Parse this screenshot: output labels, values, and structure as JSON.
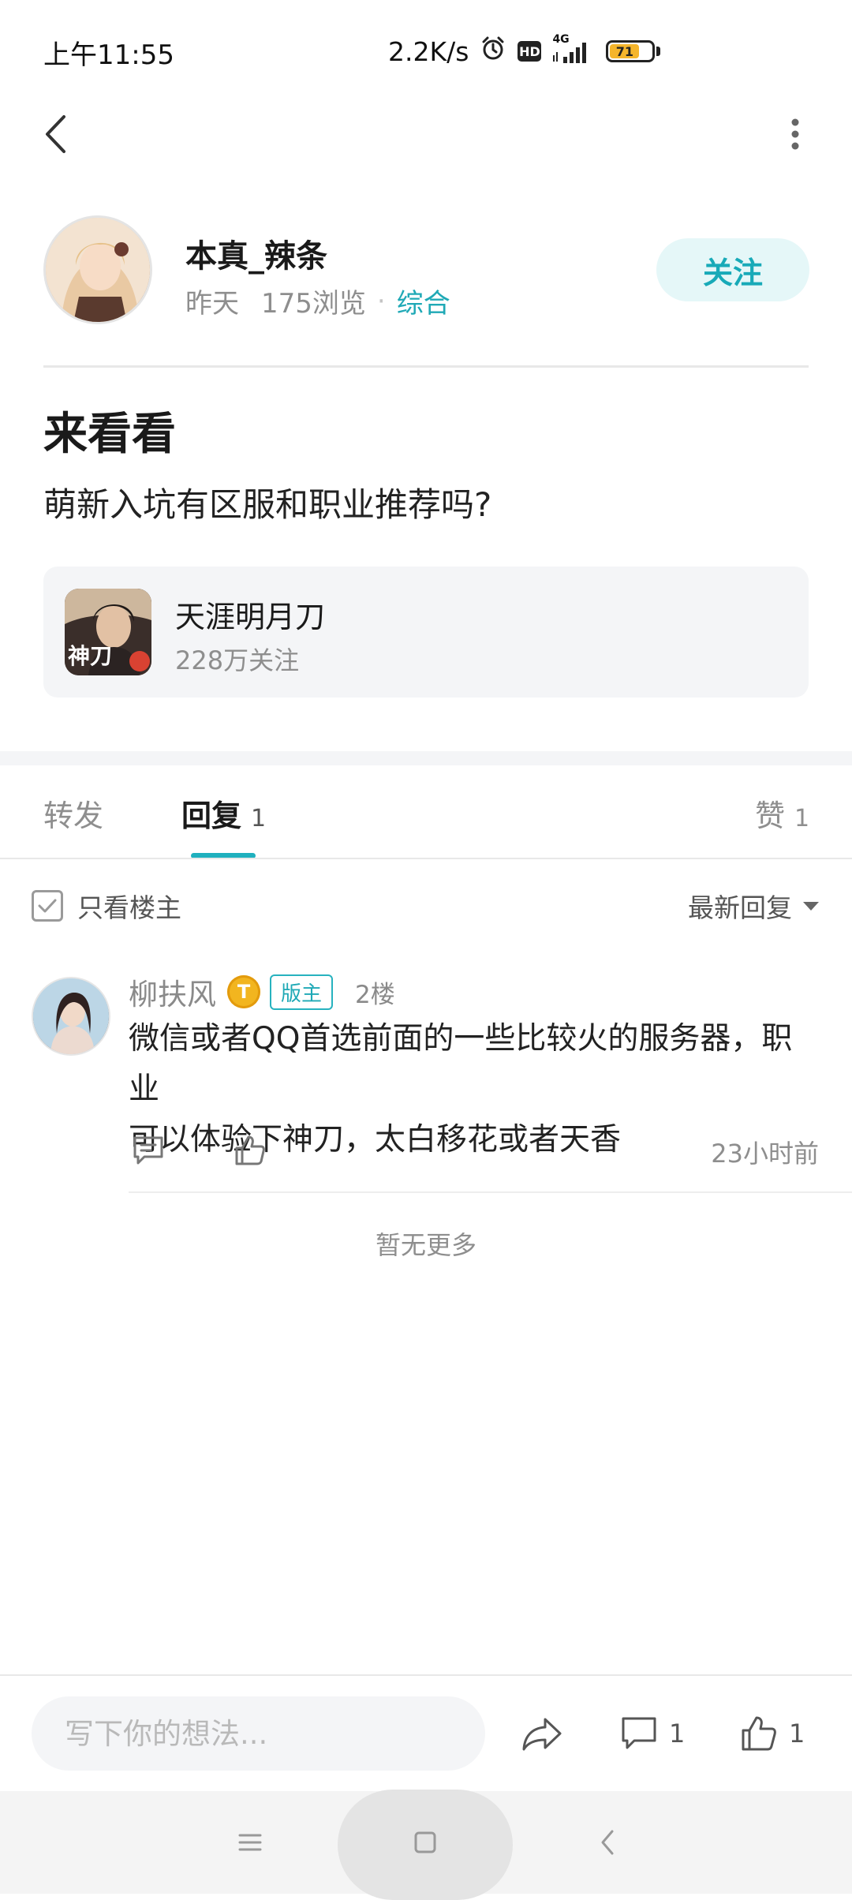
{
  "status_bar": {
    "time": "上午11:55",
    "speed": "2.2K/s",
    "hd": "HD",
    "network": "4G",
    "battery": "71",
    "battery_level": 0.71
  },
  "author": {
    "name": "本真_辣条",
    "date": "昨天",
    "views": "175浏览",
    "separator": "·",
    "category": "综合",
    "follow_label": "关注"
  },
  "post": {
    "title": "来看看",
    "body": "萌新入坑有区服和职业推荐吗?"
  },
  "game": {
    "name": "天涯明月刀",
    "followers": "228万关注",
    "icon_text": "神刀"
  },
  "tabs": [
    {
      "label": "转发",
      "count": ""
    },
    {
      "label": "回复",
      "count": "1"
    },
    {
      "label": "赞",
      "count": "1"
    }
  ],
  "filter": {
    "only_host_label": "只看楼主",
    "sort_label": "最新回复"
  },
  "reply": {
    "user": "柳扶风",
    "level": "T",
    "role": "版主",
    "floor": "2楼",
    "line1": "微信或者QQ首选前面的一些比较火的服务器，职业",
    "line2": "可以体验下神刀，太白移花或者天香",
    "time": "23小时前"
  },
  "no_more": "暂无更多",
  "bottom_bar": {
    "input_placeholder": "写下你的想法...",
    "comment_count": "1",
    "like_count": "1"
  },
  "colors": {
    "accent": "#1fa9b6",
    "follow_bg": "#e5f7f8",
    "badge_gold": "#f2b51f"
  }
}
